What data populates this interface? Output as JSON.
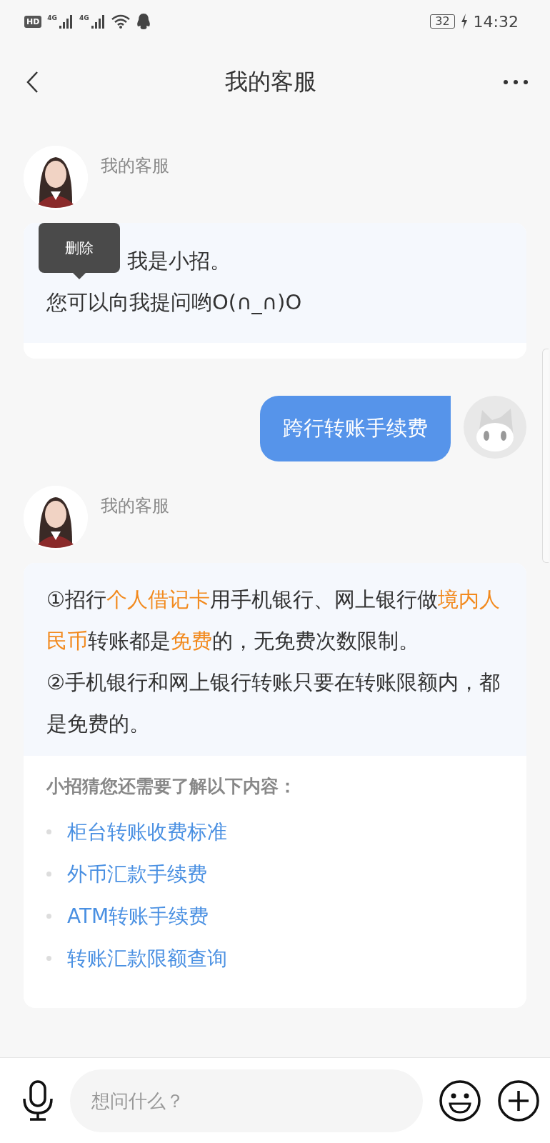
{
  "status_bar": {
    "left_badge": "HD",
    "network_1": "4G",
    "network_2": "4G",
    "battery": "32",
    "time": "14:32"
  },
  "nav": {
    "title": "我的客服"
  },
  "messages": [
    {
      "kind": "bot",
      "sender": "我的客服",
      "lines": [
        "我是小招。",
        "您可以向我提问哟O(∩_∩)O"
      ],
      "tooltip": "删除"
    },
    {
      "kind": "user",
      "text": "跨行转账手续费"
    },
    {
      "kind": "bot",
      "sender": "我的客服",
      "paragraphs": [
        [
          {
            "text": "①招行",
            "highlight": false
          },
          {
            "text": "个人借记卡",
            "highlight": true
          },
          {
            "text": "用手机银行、网上银行做",
            "highlight": false
          },
          {
            "text": "境内人民币",
            "highlight": true
          },
          {
            "text": "转账都是",
            "highlight": false
          },
          {
            "text": "免费",
            "highlight": true
          },
          {
            "text": "的，无免费次数限制。",
            "highlight": false
          }
        ],
        [
          {
            "text": "②手机银行和网上银行转账只要在转账限额内，都是免费的。",
            "highlight": false
          }
        ]
      ],
      "suggest_title": "小招猜您还需要了解以下内容：",
      "suggestions": [
        "柜台转账收费标准",
        "外币汇款手续费",
        "ATM转账手续费",
        "转账汇款限额查询"
      ]
    }
  ],
  "input": {
    "placeholder": "想问什么？"
  }
}
